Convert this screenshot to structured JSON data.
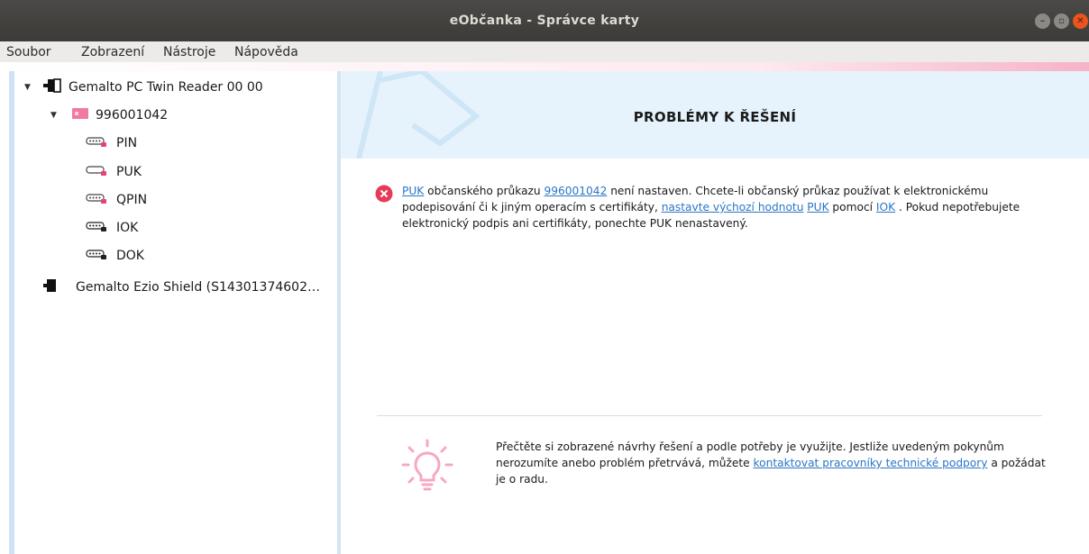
{
  "window": {
    "title": "eObčanka - Správce karty"
  },
  "menubar": {
    "items": [
      "Soubor",
      "Zobrazení",
      "Nástroje",
      "Nápověda"
    ]
  },
  "tree": {
    "reader1": {
      "label": "Gemalto PC Twin Reader 00 00",
      "icon": "card-reader-icon"
    },
    "card": {
      "label": "996001042",
      "icon": "id-card-icon"
    },
    "pins": [
      {
        "label": "PIN",
        "icon": "pin-keypad-icon",
        "status_color": "#e8427c"
      },
      {
        "label": "PUK",
        "icon": "puk-key-icon",
        "status_color": "#e8427c"
      },
      {
        "label": "QPIN",
        "icon": "pin-keypad-icon",
        "status_color": "#e8427c"
      },
      {
        "label": "IOK",
        "icon": "pin-keypad-icon",
        "status_color": "#222222"
      },
      {
        "label": "DOK",
        "icon": "pin-keypad-icon",
        "status_color": "#222222"
      }
    ],
    "reader2": {
      "label": "Gemalto Ezio Shield (S14301374602…",
      "icon": "card-reader-icon"
    }
  },
  "main": {
    "banner_title": "PROBLÉMY K ŘEŠENÍ",
    "problem": {
      "link_puk1": "PUK",
      "t1": " občanského průkazu ",
      "link_card": "996001042",
      "t2": " není nastaven. Chcete-li občanský průkaz používat k elektronickému podepisování či k jiným operacím s certifikáty, ",
      "link_default": "nastavte výchozí hodnotu",
      "t3": " ",
      "link_puk2": "PUK",
      "t4": " pomocí ",
      "link_iok": "IOK",
      "t5": " . Pokud nepotřebujete elektronický podpis ani certifikáty, ponechte PUK nenastavený."
    },
    "tip": {
      "t1": "Přečtěte si zobrazené návrhy řešení a podle potřeby je využijte. Jestliže uvedeným pokynům nerozumíte anebo problém přetrvává, můžete ",
      "link_support": "kontaktovat pracovníky technické podpory",
      "t2": " a požádat je o radu."
    }
  },
  "colors": {
    "accent_pink": "#e8427c",
    "link": "#2a76c6",
    "error": "#e63a55",
    "banner_bg": "#e6f3fc"
  }
}
